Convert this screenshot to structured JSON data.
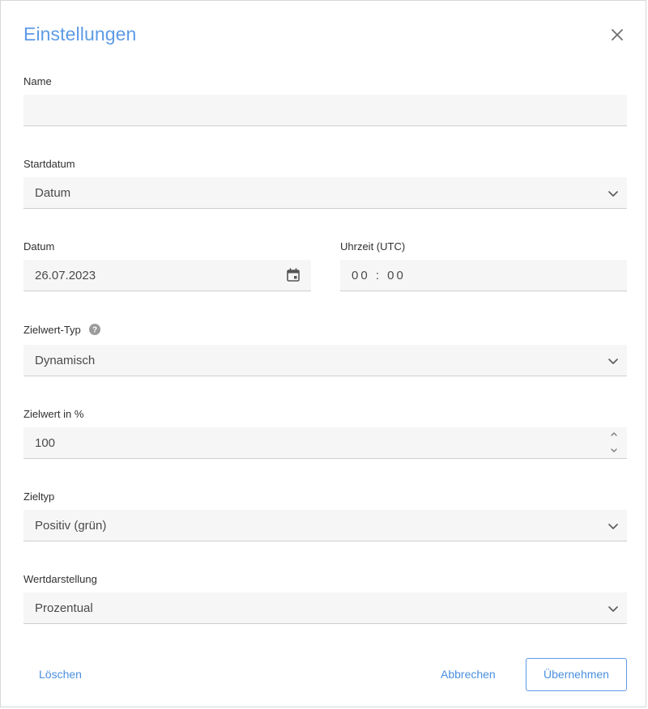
{
  "dialog": {
    "title": "Einstellungen",
    "close_icon": "close-icon"
  },
  "fields": {
    "name": {
      "label": "Name",
      "value": ""
    },
    "startdatum": {
      "label": "Startdatum",
      "value": "Datum"
    },
    "datum": {
      "label": "Datum",
      "value": "26.07.2023",
      "icon": "calendar-icon"
    },
    "uhrzeit": {
      "label": "Uhrzeit (UTC)",
      "value": "00 : 00"
    },
    "zielwert_typ": {
      "label": "Zielwert-Typ",
      "value": "Dynamisch",
      "help_icon": "help-icon"
    },
    "zielwert": {
      "label": "Zielwert in %",
      "value": "100"
    },
    "zieltyp": {
      "label": "Zieltyp",
      "value": "Positiv (grün)"
    },
    "wertdarstellung": {
      "label": "Wertdarstellung",
      "value": "Prozentual"
    }
  },
  "footer": {
    "delete_label": "Löschen",
    "cancel_label": "Abbrechen",
    "apply_label": "Übernehmen"
  },
  "colors": {
    "accent": "#5d9be6",
    "field_bg": "#f6f6f6",
    "field_border": "#cfcfcf"
  }
}
